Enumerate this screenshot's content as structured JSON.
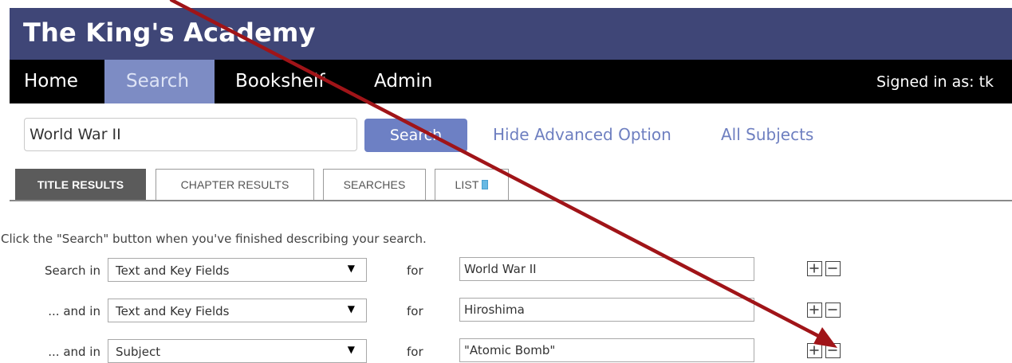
{
  "app": {
    "title": "The King's Academy"
  },
  "nav": {
    "items": [
      {
        "label": "Home",
        "active": false
      },
      {
        "label": "Search",
        "active": true
      },
      {
        "label": "Bookshelf",
        "active": false
      },
      {
        "label": "Admin",
        "active": false
      }
    ],
    "signed_in": "Signed in as:  tk"
  },
  "search": {
    "query": "World War II",
    "button_label": "Search",
    "links": {
      "advanced": "Hide Advanced Option",
      "subjects": "All Subjects"
    }
  },
  "tabs": [
    {
      "label": "TITLE RESULTS",
      "active": true
    },
    {
      "label": "CHAPTER RESULTS",
      "active": false
    },
    {
      "label": "SEARCHES",
      "active": false
    },
    {
      "label": "LIST",
      "active": false,
      "icon": "list-icon"
    }
  ],
  "advanced": {
    "instructions": "Click the \"Search\" button when you've finished describing your search.",
    "rows": [
      {
        "label": "Search in",
        "field": "Text and Key Fields",
        "for_label": "for",
        "term": "World War II"
      },
      {
        "label": "... and in",
        "field": "Text and Key Fields",
        "for_label": "for",
        "term": "Hiroshima"
      },
      {
        "label": "... and in",
        "field": "Subject",
        "for_label": "for",
        "term": "\"Atomic Bomb\""
      }
    ]
  },
  "colors": {
    "header_bg": "#3f4677",
    "nav_bg": "#000000",
    "nav_active": "#7d8cc4",
    "accent": "#6d80c4",
    "annotation_arrow": "#a01418"
  }
}
